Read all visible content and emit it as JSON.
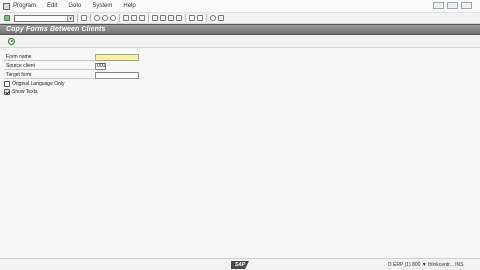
{
  "menu": {
    "items": [
      "Program",
      "Edit",
      "Goto",
      "System",
      "Help"
    ]
  },
  "title_bar": {
    "title": "Copy Forms Between Clients"
  },
  "form": {
    "fields": [
      {
        "label": "Form name",
        "value": ""
      },
      {
        "label": "Source client",
        "value": "000"
      },
      {
        "label": "Target form",
        "value": ""
      }
    ],
    "checkboxes": [
      {
        "label": "Original Language Only",
        "checked": false
      },
      {
        "label": "Show Texts",
        "checked": true
      }
    ]
  },
  "status_bar": {
    "logo_text": "SAP",
    "system_info": "D   ERP (1) 800  ▼  thinkcentr...  INS"
  }
}
